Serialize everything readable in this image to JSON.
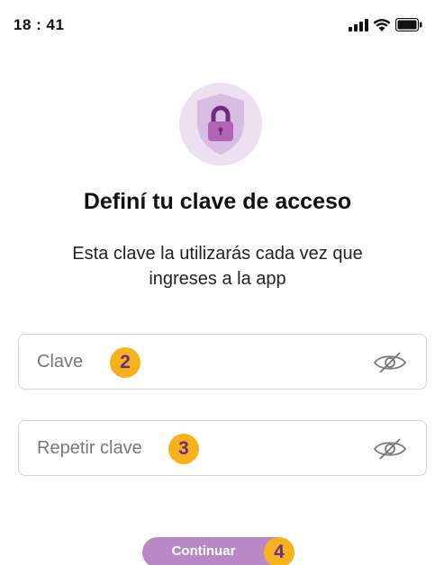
{
  "status_bar": {
    "time": "18 : 41",
    "icons": [
      "signal-icon",
      "wifi-icon",
      "battery-icon"
    ]
  },
  "hero": {
    "icon": "shield-lock-icon"
  },
  "title": "Definí tu clave de acceso",
  "subtitle": "Esta clave la utilizarás cada vez que ingreses a la app",
  "fields": [
    {
      "placeholder": "Clave",
      "value": "",
      "badge": "2",
      "toggle_icon": "eye-off-icon"
    },
    {
      "placeholder": "Repetir clave",
      "value": "",
      "badge": "3",
      "toggle_icon": "eye-off-icon"
    }
  ],
  "continue_button": {
    "label": "Continuar",
    "badge": "4"
  },
  "colors": {
    "brand_purple": "#7b3f96",
    "button_purple": "#b787c6",
    "badge_yellow": "#f5b21d",
    "field_border": "#d4d4d4"
  }
}
